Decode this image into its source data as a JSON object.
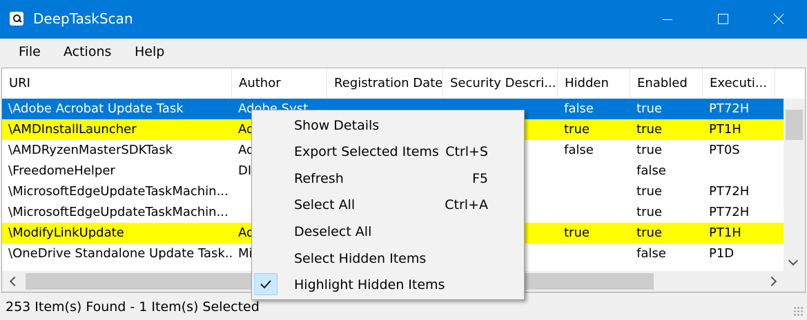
{
  "window": {
    "title": "DeepTaskScan"
  },
  "menu": [
    "File",
    "Actions",
    "Help"
  ],
  "columns": [
    "URI",
    "Author",
    "Registration Date",
    "Security Descri...",
    "Hidden",
    "Enabled",
    "Executi..."
  ],
  "rows": [
    {
      "state": "selected",
      "cells": [
        "\\Adobe Acrobat Update Task",
        "Adobe Syst...",
        "",
        "",
        "false",
        "true",
        "PT72H"
      ]
    },
    {
      "state": "highlight",
      "cells": [
        "\\AMDInstallLauncher",
        "Ad",
        "",
        "",
        "true",
        "true",
        "PT1H"
      ]
    },
    {
      "state": "normal",
      "cells": [
        "\\AMDRyzenMasterSDKTask",
        "Ad",
        "",
        "",
        "false",
        "true",
        "PT0S"
      ]
    },
    {
      "state": "normal",
      "cells": [
        "\\FreedomeHelper",
        "DI",
        "",
        "",
        "",
        "false",
        ""
      ]
    },
    {
      "state": "normal",
      "cells": [
        "\\MicrosoftEdgeUpdateTaskMachin...",
        "",
        "",
        "",
        "",
        "true",
        "PT72H"
      ]
    },
    {
      "state": "normal",
      "cells": [
        "\\MicrosoftEdgeUpdateTaskMachin...",
        "",
        "",
        "",
        "",
        "true",
        "PT72H"
      ]
    },
    {
      "state": "highlight",
      "cells": [
        "\\ModifyLinkUpdate",
        "Ad",
        "",
        "",
        "true",
        "true",
        "PT1H"
      ]
    },
    {
      "state": "normal",
      "cells": [
        "\\OneDrive Standalone Update Task...",
        "Mi",
        "",
        "",
        "",
        "false",
        "P1D"
      ]
    }
  ],
  "context_menu": [
    {
      "label": "Show Details",
      "shortcut": ""
    },
    {
      "label": "Export Selected Items",
      "shortcut": "Ctrl+S"
    },
    {
      "label": "Refresh",
      "shortcut": "F5"
    },
    {
      "label": "Select All",
      "shortcut": "Ctrl+A"
    },
    {
      "label": "Deselect All",
      "shortcut": ""
    },
    {
      "label": "Select Hidden Items",
      "shortcut": ""
    },
    {
      "label": "Highlight Hidden Items",
      "shortcut": "",
      "checked": true
    }
  ],
  "status": "253 Item(s) Found - 1 Item(s) Selected",
  "colors": {
    "titlebar": "#0078d7",
    "selection": "#0078d7",
    "hidden_highlight": "#ffff00",
    "menu_check": "#cce8ff"
  }
}
